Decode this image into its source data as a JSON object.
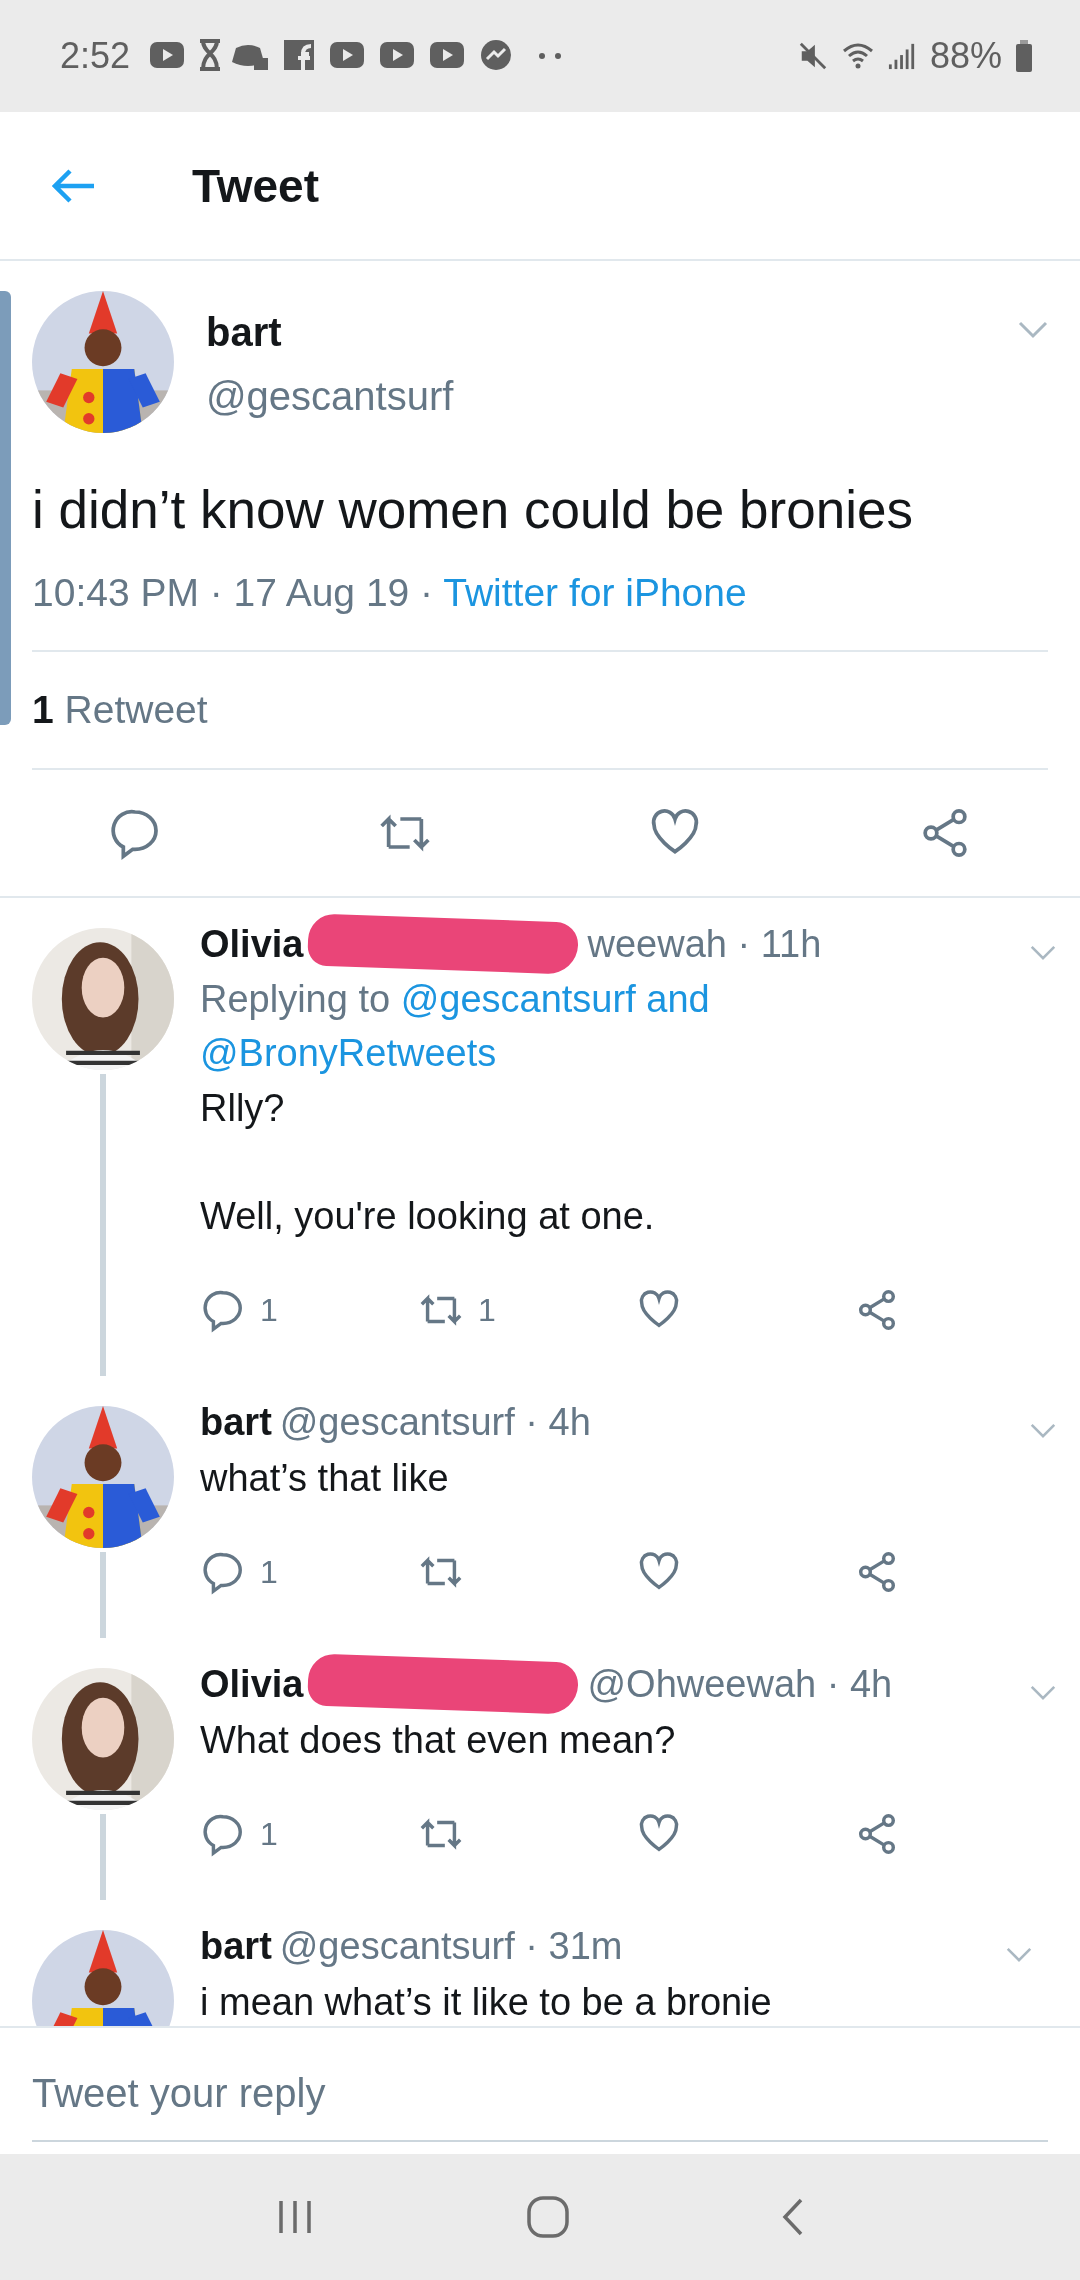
{
  "status_bar": {
    "time": "2:52",
    "battery": "88%"
  },
  "header": {
    "title": "Tweet"
  },
  "tweet": {
    "name": "bart",
    "handle": "@gescantsurf",
    "avatar": {
      "kind": "picture"
    },
    "text": "i didn’t know women could be bronies",
    "meta": "10:43 PM · 17 Aug 19 ·",
    "source": "Twitter for iPhone",
    "retweet_count": "1",
    "retweet_label": "Retweet"
  },
  "replies": [
    {
      "name": "Olivia",
      "redacted": true,
      "handle_time": "weewah · 11h",
      "avatar": {
        "kind": "picture"
      },
      "replying_prefix": "Replying to",
      "mentions": [
        "@gescantsurf and",
        "@BronyRetweets"
      ],
      "paragraphs": [
        "Rlly?",
        "Well, you're looking at one."
      ],
      "reply_count": "1",
      "retweet_count": "1"
    },
    {
      "name": "bart",
      "redacted": false,
      "handle_time": "@gescantsurf · 4h",
      "avatar": {
        "kind": "picture"
      },
      "paragraphs": [
        "what’s that like"
      ],
      "reply_count": "1"
    },
    {
      "name": "Olivia",
      "redacted": true,
      "handle_time": "@Ohweewah · 4h",
      "avatar": {
        "kind": "picture"
      },
      "paragraphs": [
        "What does that even mean?"
      ],
      "reply_count": "1"
    },
    {
      "name": "bart",
      "redacted": false,
      "handle_time": "@gescantsurf · 31m",
      "avatar": {
        "kind": "picture"
      },
      "paragraphs": [
        "i mean what’s it like to be a bronie"
      ]
    }
  ],
  "reply_bar": {
    "placeholder": "Tweet your reply"
  }
}
